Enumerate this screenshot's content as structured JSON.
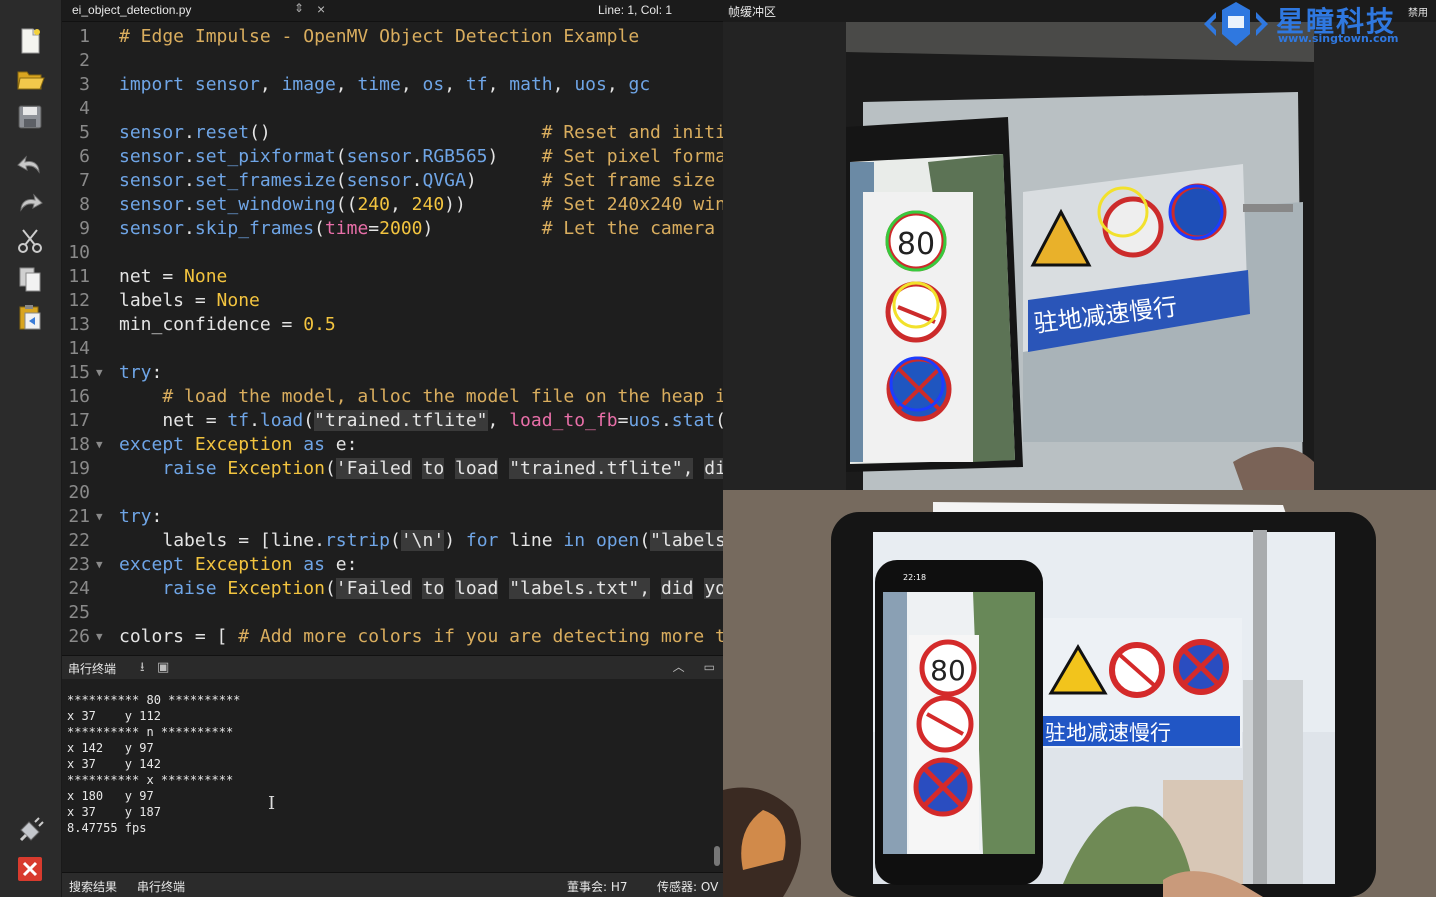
{
  "editor": {
    "file_name": "ei_object_detection.py",
    "cursor_position": "Line: 1, Col: 1",
    "lines": [
      {
        "n": "1",
        "segs": [
          [
            "cm",
            "# Edge Impulse - OpenMV Object Detection Example"
          ]
        ]
      },
      {
        "n": "2",
        "segs": []
      },
      {
        "n": "3",
        "segs": [
          [
            "kw",
            "import"
          ],
          [
            "p",
            " "
          ],
          [
            "mod",
            "sensor"
          ],
          [
            "p",
            ", "
          ],
          [
            "mod",
            "image"
          ],
          [
            "p",
            ", "
          ],
          [
            "mod",
            "time"
          ],
          [
            "p",
            ", "
          ],
          [
            "mod",
            "os"
          ],
          [
            "p",
            ", "
          ],
          [
            "mod",
            "tf"
          ],
          [
            "p",
            ", "
          ],
          [
            "mod",
            "math"
          ],
          [
            "p",
            ", "
          ],
          [
            "mod",
            "uos"
          ],
          [
            "p",
            ", "
          ],
          [
            "mod",
            "gc"
          ]
        ]
      },
      {
        "n": "4",
        "segs": []
      },
      {
        "n": "5",
        "segs": [
          [
            "mod",
            "sensor"
          ],
          [
            "p",
            "."
          ],
          [
            "mod",
            "reset"
          ],
          [
            "p",
            "()                         "
          ],
          [
            "cm",
            "# Reset and initi"
          ]
        ]
      },
      {
        "n": "6",
        "segs": [
          [
            "mod",
            "sensor"
          ],
          [
            "p",
            "."
          ],
          [
            "mod",
            "set_pixformat"
          ],
          [
            "p",
            "("
          ],
          [
            "mod",
            "sensor"
          ],
          [
            "p",
            "."
          ],
          [
            "mod",
            "RGB565"
          ],
          [
            "p",
            ")    "
          ],
          [
            "cm",
            "# Set pixel forma"
          ]
        ]
      },
      {
        "n": "7",
        "segs": [
          [
            "mod",
            "sensor"
          ],
          [
            "p",
            "."
          ],
          [
            "mod",
            "set_framesize"
          ],
          [
            "p",
            "("
          ],
          [
            "mod",
            "sensor"
          ],
          [
            "p",
            "."
          ],
          [
            "mod",
            "QVGA"
          ],
          [
            "p",
            ")      "
          ],
          [
            "cm",
            "# Set frame size "
          ]
        ]
      },
      {
        "n": "8",
        "segs": [
          [
            "mod",
            "sensor"
          ],
          [
            "p",
            "."
          ],
          [
            "mod",
            "set_windowing"
          ],
          [
            "p",
            "(("
          ],
          [
            "nm",
            "240"
          ],
          [
            "p",
            ", "
          ],
          [
            "nm",
            "240"
          ],
          [
            "p",
            "))       "
          ],
          [
            "cm",
            "# Set 240x240 win"
          ]
        ]
      },
      {
        "n": "9",
        "segs": [
          [
            "mod",
            "sensor"
          ],
          [
            "p",
            "."
          ],
          [
            "mod",
            "skip_frames"
          ],
          [
            "p",
            "("
          ],
          [
            "arg",
            "time"
          ],
          [
            "p",
            "="
          ],
          [
            "nm",
            "2000"
          ],
          [
            "p",
            ")          "
          ],
          [
            "cm",
            "# Let the camera "
          ]
        ]
      },
      {
        "n": "10",
        "segs": []
      },
      {
        "n": "11",
        "segs": [
          [
            "n",
            "net"
          ],
          [
            "p",
            " = "
          ],
          [
            "nm",
            "None"
          ]
        ]
      },
      {
        "n": "12",
        "segs": [
          [
            "n",
            "labels"
          ],
          [
            "p",
            " = "
          ],
          [
            "nm",
            "None"
          ]
        ]
      },
      {
        "n": "13",
        "segs": [
          [
            "n",
            "min_confidence"
          ],
          [
            "p",
            " = "
          ],
          [
            "nm",
            "0.5"
          ]
        ]
      },
      {
        "n": "14",
        "segs": []
      },
      {
        "n": "15",
        "fold": true,
        "segs": [
          [
            "kw",
            "try"
          ],
          [
            "p",
            ":"
          ]
        ]
      },
      {
        "n": "16",
        "segs": [
          [
            "p",
            "    "
          ],
          [
            "cm",
            "# load the model, alloc the model file on the heap i"
          ]
        ]
      },
      {
        "n": "17",
        "segs": [
          [
            "p",
            "    "
          ],
          [
            "n",
            "net"
          ],
          [
            "p",
            " = "
          ],
          [
            "mod",
            "tf"
          ],
          [
            "p",
            "."
          ],
          [
            "mod",
            "load"
          ],
          [
            "p",
            "("
          ],
          [
            "str",
            "\"trained.tflite\""
          ],
          [
            "p",
            ", "
          ],
          [
            "arg",
            "load_to_fb"
          ],
          [
            "p",
            "="
          ],
          [
            "mod",
            "uos"
          ],
          [
            "p",
            "."
          ],
          [
            "mod",
            "stat"
          ],
          [
            "p",
            "("
          ]
        ]
      },
      {
        "n": "18",
        "fold": true,
        "segs": [
          [
            "kw",
            "except"
          ],
          [
            "p",
            " "
          ],
          [
            "nm",
            "Exception"
          ],
          [
            "p",
            " "
          ],
          [
            "kw",
            "as"
          ],
          [
            "p",
            " e:"
          ]
        ]
      },
      {
        "n": "19",
        "segs": [
          [
            "p",
            "    "
          ],
          [
            "kw",
            "raise"
          ],
          [
            "p",
            " "
          ],
          [
            "nm",
            "Exception"
          ],
          [
            "p",
            "("
          ],
          [
            "str",
            "'Failed"
          ],
          [
            "p",
            " "
          ],
          [
            "str",
            "to"
          ],
          [
            "p",
            " "
          ],
          [
            "str",
            "load"
          ],
          [
            "p",
            " "
          ],
          [
            "str",
            "\"trained.tflite\","
          ],
          [
            "p",
            " "
          ],
          [
            "str",
            "di"
          ]
        ]
      },
      {
        "n": "20",
        "segs": []
      },
      {
        "n": "21",
        "fold": true,
        "segs": [
          [
            "kw",
            "try"
          ],
          [
            "p",
            ":"
          ]
        ]
      },
      {
        "n": "22",
        "segs": [
          [
            "p",
            "    "
          ],
          [
            "n",
            "labels"
          ],
          [
            "p",
            " = ["
          ],
          [
            "n",
            "line"
          ],
          [
            "p",
            "."
          ],
          [
            "mod",
            "rstrip"
          ],
          [
            "p",
            "("
          ],
          [
            "str",
            "'\\n'"
          ],
          [
            "p",
            ") "
          ],
          [
            "kw",
            "for"
          ],
          [
            "p",
            " line "
          ],
          [
            "kw",
            "in"
          ],
          [
            "p",
            " "
          ],
          [
            "mod",
            "open"
          ],
          [
            "p",
            "("
          ],
          [
            "str",
            "\"labels"
          ]
        ]
      },
      {
        "n": "23",
        "fold": true,
        "segs": [
          [
            "kw",
            "except"
          ],
          [
            "p",
            " "
          ],
          [
            "nm",
            "Exception"
          ],
          [
            "p",
            " "
          ],
          [
            "kw",
            "as"
          ],
          [
            "p",
            " e:"
          ]
        ]
      },
      {
        "n": "24",
        "segs": [
          [
            "p",
            "    "
          ],
          [
            "kw",
            "raise"
          ],
          [
            "p",
            " "
          ],
          [
            "nm",
            "Exception"
          ],
          [
            "p",
            "("
          ],
          [
            "str",
            "'Failed"
          ],
          [
            "p",
            " "
          ],
          [
            "str",
            "to"
          ],
          [
            "p",
            " "
          ],
          [
            "str",
            "load"
          ],
          [
            "p",
            " "
          ],
          [
            "str",
            "\"labels.txt\","
          ],
          [
            "p",
            " "
          ],
          [
            "str",
            "did"
          ],
          [
            "p",
            " "
          ],
          [
            "str",
            "yo"
          ]
        ]
      },
      {
        "n": "25",
        "segs": []
      },
      {
        "n": "26",
        "fold": true,
        "segs": [
          [
            "n",
            "colors"
          ],
          [
            "p",
            " = [ "
          ],
          [
            "cm",
            "# Add more colors if you are detecting more t"
          ]
        ]
      }
    ]
  },
  "terminal": {
    "title": "串行终端",
    "lines": [
      "********** 80 **********",
      "x 37    y 112",
      "********** n **********",
      "x 142   y 97",
      "x 37    y 142",
      "********** x **********",
      "x 180   y 97",
      "x 37    y 187",
      "8.47755 fps"
    ]
  },
  "status_bar": {
    "search_results": "搜索结果",
    "serial_terminal": "串行终端",
    "board": "董事会: H7",
    "sensor": "传感器: OV"
  },
  "frame_buffer": {
    "title": "帧缓冲区",
    "sign_text": "驻地减速慢行",
    "speed_limit": "80",
    "phone_time": "22:18"
  },
  "logo": {
    "name": "星瞳科技",
    "url": "www.singtown.com",
    "tail": "禁用"
  },
  "colors": {
    "background": "#1e1e1e",
    "keyword": "#6fa5e6",
    "comment": "#d9ad5e",
    "number": "#f3c43f",
    "argument": "#e86fa8",
    "brand": "#2f78e0"
  }
}
